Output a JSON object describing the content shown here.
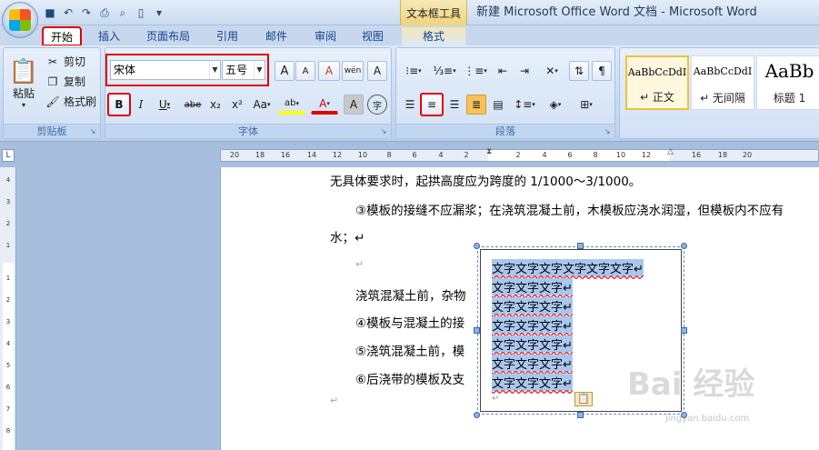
{
  "window": {
    "title": "新建 Microsoft Office Word 文档 - Microsoft Word",
    "context_tool": "文本框工具"
  },
  "quick_access": {
    "icons": [
      "save-icon",
      "undo-icon",
      "redo-icon",
      "print-icon",
      "print-preview-icon",
      "new-document-icon",
      "customize-icon"
    ]
  },
  "tabs": [
    "开始",
    "插入",
    "页面布局",
    "引用",
    "邮件",
    "审阅",
    "视图",
    "格式"
  ],
  "clipboard": {
    "paste": "粘贴",
    "cut": "剪切",
    "copy": "复制",
    "format_painter": "格式刷",
    "group_label": "剪贴板"
  },
  "font": {
    "name": "宋体",
    "size": "五号",
    "group_label": "字体",
    "bold": "B",
    "italic": "I",
    "underline": "U",
    "strike": "abe",
    "subscript": "x₂",
    "superscript": "x²",
    "change_case": "Aa",
    "highlight": "ab",
    "font_color": "A",
    "char_shading": "A",
    "enclose": "字",
    "grow": "A",
    "shrink": "A",
    "clear_format": "A",
    "phonetic": "wén",
    "border": "A"
  },
  "paragraph": {
    "group_label": "段落"
  },
  "styles": {
    "items": [
      {
        "sample": "AaBbCcDdI",
        "name": "↵ 正文"
      },
      {
        "sample": "AaBbCcDdI",
        "name": "↵ 无间隔"
      },
      {
        "sample": "AaBb",
        "name": "标题 1"
      }
    ]
  },
  "ruler": {
    "ticks": [
      "20",
      "18",
      "16",
      "14",
      "12",
      "10",
      "8",
      "6",
      "4",
      "2",
      "2",
      "4",
      "6",
      "8",
      "10",
      "12",
      "16",
      "18",
      "20"
    ],
    "corner": "L",
    "vticks": [
      "4",
      "3",
      "2",
      "1",
      "1",
      "2",
      "3",
      "4",
      "5",
      "6",
      "7",
      "8"
    ]
  },
  "document": {
    "lines": [
      "无具体要求时，起拱高度应为跨度的 1/1000～3/1000。",
      "③模板的接缝不应漏浆；在浇筑混凝土前，木模板应浇水润湿，但模板内不应有",
      "水；↵",
      "↵",
      "浇筑混凝土前，杂物",
      "④模板与混凝土的接",
      "⑤浇筑混凝土前，模",
      "⑥后浇带的模板及支",
      "↵"
    ]
  },
  "textbox": {
    "lines": [
      "文字文字文字文字文字文字↵",
      "文字文字文字↵",
      "文字文字文字↵",
      "文字文字文字↵",
      "文字文字文字↵",
      "文字文字文字↵",
      "文字文字文字↵"
    ],
    "end_mark": "↵"
  },
  "watermark": {
    "logo": "Bai 经验",
    "url": "jingyan.baidu.com"
  }
}
